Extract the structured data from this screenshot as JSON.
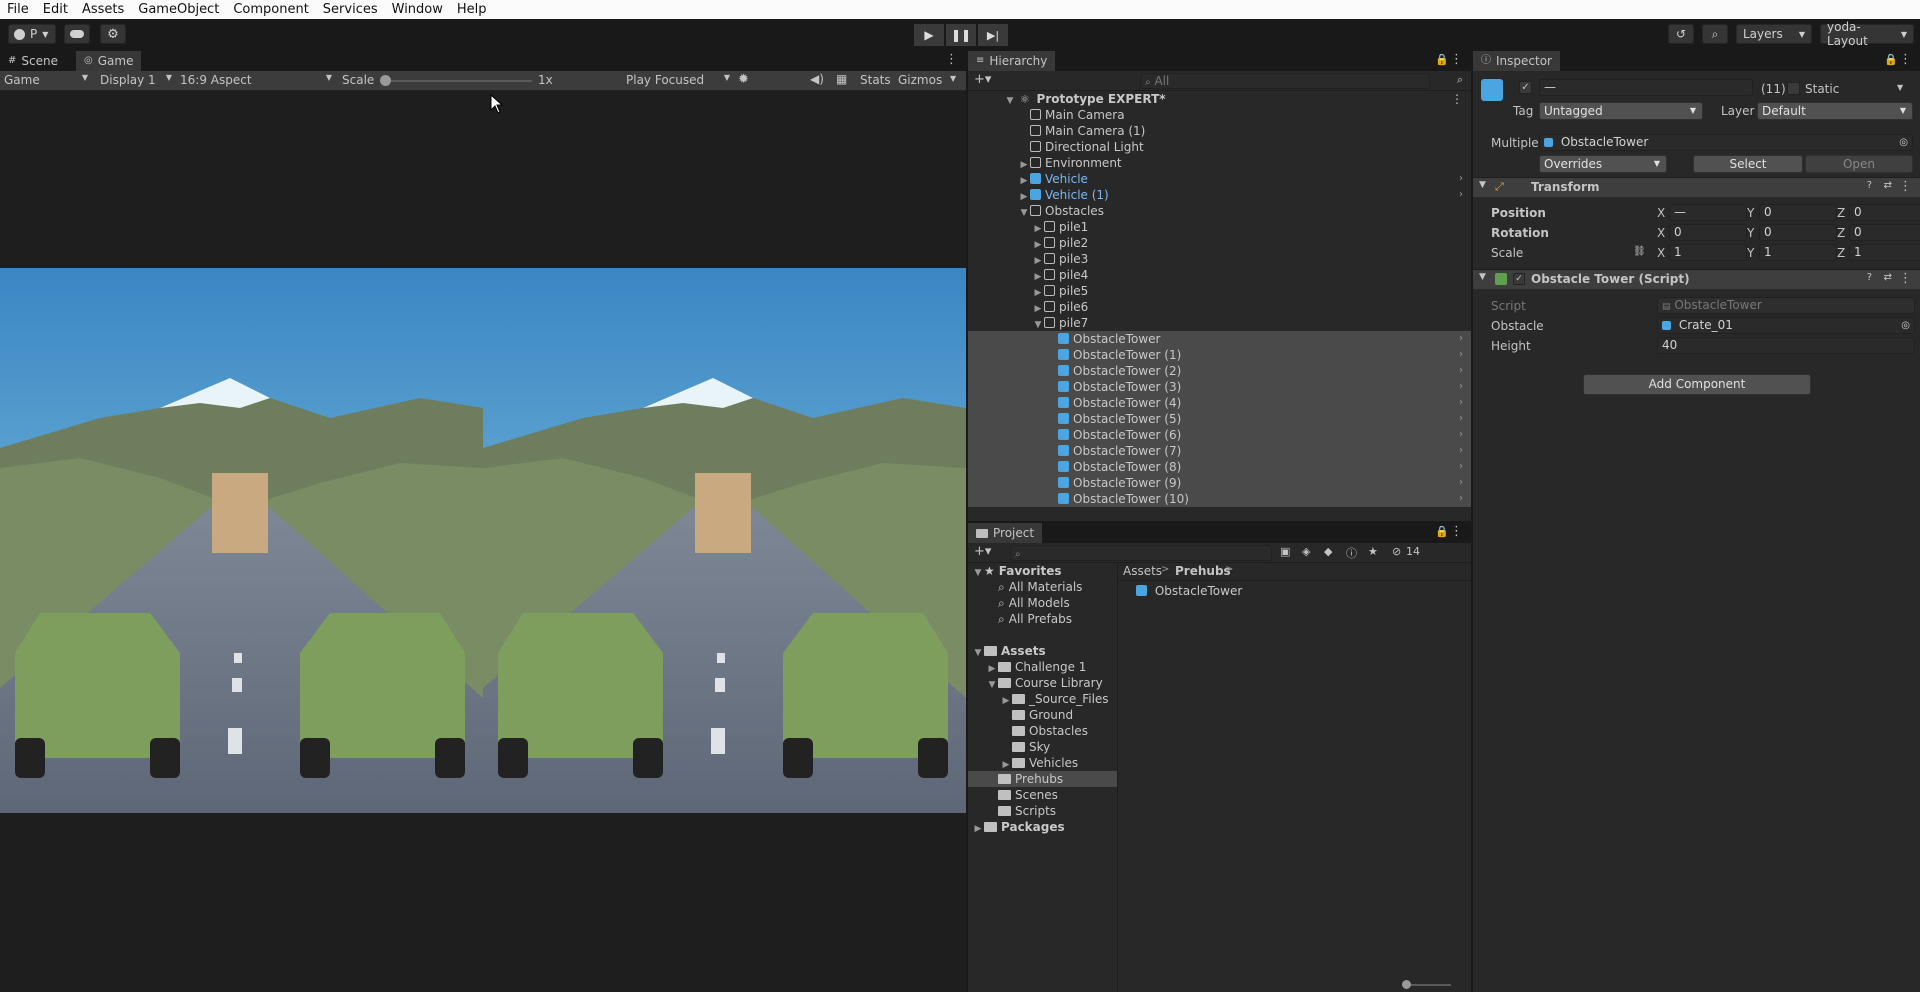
{
  "menu": [
    "File",
    "Edit",
    "Assets",
    "GameObject",
    "Component",
    "Services",
    "Window",
    "Help"
  ],
  "toolbar": {
    "account": "P",
    "layers": "Layers",
    "layout": "yoda-Layout"
  },
  "game_view": {
    "tabs": [
      "Scene",
      "Game"
    ],
    "display_mode": "Game",
    "display": "Display 1",
    "aspect": "16:9 Aspect",
    "scale_label": "Scale",
    "scale_value": "1x",
    "play_mode": "Play Focused",
    "stats": "Stats",
    "gizmos": "Gizmos"
  },
  "hierarchy": {
    "title": "Hierarchy",
    "search_placeholder": "All",
    "scene": "Prototype EXPERT*",
    "rows": [
      {
        "label": "Main Camera",
        "indent": 1,
        "icon": "cube",
        "arrow": ""
      },
      {
        "label": "Main Camera (1)",
        "indent": 1,
        "icon": "cube",
        "arrow": ""
      },
      {
        "label": "Directional Light",
        "indent": 1,
        "icon": "cube",
        "arrow": ""
      },
      {
        "label": "Environment",
        "indent": 1,
        "icon": "cube",
        "arrow": "▶"
      },
      {
        "label": "Vehicle",
        "indent": 1,
        "icon": "blue",
        "arrow": "▶",
        "blue": true
      },
      {
        "label": "Vehicle (1)",
        "indent": 1,
        "icon": "blue",
        "arrow": "▶",
        "blue": true
      },
      {
        "label": "Obstacles",
        "indent": 1,
        "icon": "cube",
        "arrow": "▼"
      },
      {
        "label": "pile1",
        "indent": 2,
        "icon": "cube",
        "arrow": "▶"
      },
      {
        "label": "pile2",
        "indent": 2,
        "icon": "cube",
        "arrow": "▶"
      },
      {
        "label": "pile3",
        "indent": 2,
        "icon": "cube",
        "arrow": "▶"
      },
      {
        "label": "pile4",
        "indent": 2,
        "icon": "cube",
        "arrow": "▶"
      },
      {
        "label": "pile5",
        "indent": 2,
        "icon": "cube",
        "arrow": "▶"
      },
      {
        "label": "pile6",
        "indent": 2,
        "icon": "cube",
        "arrow": "▶"
      },
      {
        "label": "pile7",
        "indent": 2,
        "icon": "cube",
        "arrow": "▼"
      },
      {
        "label": "ObstacleTower",
        "indent": 3,
        "icon": "blue",
        "arrow": "",
        "sel": true
      },
      {
        "label": "ObstacleTower (1)",
        "indent": 3,
        "icon": "blue",
        "arrow": "",
        "sel": true
      },
      {
        "label": "ObstacleTower (2)",
        "indent": 3,
        "icon": "blue",
        "arrow": "",
        "sel": true
      },
      {
        "label": "ObstacleTower (3)",
        "indent": 3,
        "icon": "blue",
        "arrow": "",
        "sel": true
      },
      {
        "label": "ObstacleTower (4)",
        "indent": 3,
        "icon": "blue",
        "arrow": "",
        "sel": true
      },
      {
        "label": "ObstacleTower (5)",
        "indent": 3,
        "icon": "blue",
        "arrow": "",
        "sel": true
      },
      {
        "label": "ObstacleTower (6)",
        "indent": 3,
        "icon": "blue",
        "arrow": "",
        "sel": true
      },
      {
        "label": "ObstacleTower (7)",
        "indent": 3,
        "icon": "blue",
        "arrow": "",
        "sel": true
      },
      {
        "label": "ObstacleTower (8)",
        "indent": 3,
        "icon": "blue",
        "arrow": "",
        "sel": true
      },
      {
        "label": "ObstacleTower (9)",
        "indent": 3,
        "icon": "blue",
        "arrow": "",
        "sel": true
      },
      {
        "label": "ObstacleTower (10)",
        "indent": 3,
        "icon": "blue",
        "arrow": "",
        "sel": true
      }
    ]
  },
  "project": {
    "title": "Project",
    "hidden_count": "14",
    "breadcrumb": [
      "Assets",
      "Prehubs"
    ],
    "asset": "ObstacleTower",
    "tree": [
      {
        "label": "Favorites",
        "indent": 0,
        "arrow": "▼",
        "bold": true,
        "icon": "star"
      },
      {
        "label": "All Materials",
        "indent": 1,
        "arrow": "",
        "icon": "search"
      },
      {
        "label": "All Models",
        "indent": 1,
        "arrow": "",
        "icon": "search"
      },
      {
        "label": "All Prefabs",
        "indent": 1,
        "arrow": "",
        "icon": "search"
      },
      {
        "label": "",
        "indent": 0,
        "arrow": "",
        "icon": "none"
      },
      {
        "label": "Assets",
        "indent": 0,
        "arrow": "▼",
        "bold": true,
        "icon": "folder"
      },
      {
        "label": "Challenge 1",
        "indent": 1,
        "arrow": "▶",
        "icon": "folder"
      },
      {
        "label": "Course Library",
        "indent": 1,
        "arrow": "▼",
        "icon": "folder"
      },
      {
        "label": "_Source_Files",
        "indent": 2,
        "arrow": "▶",
        "icon": "folder"
      },
      {
        "label": "Ground",
        "indent": 2,
        "arrow": "",
        "icon": "folder"
      },
      {
        "label": "Obstacles",
        "indent": 2,
        "arrow": "",
        "icon": "folder"
      },
      {
        "label": "Sky",
        "indent": 2,
        "arrow": "",
        "icon": "folder"
      },
      {
        "label": "Vehicles",
        "indent": 2,
        "arrow": "▶",
        "icon": "folder"
      },
      {
        "label": "Prehubs",
        "indent": 1,
        "arrow": "",
        "icon": "folder",
        "sel": true
      },
      {
        "label": "Scenes",
        "indent": 1,
        "arrow": "",
        "icon": "folder"
      },
      {
        "label": "Scripts",
        "indent": 1,
        "arrow": "",
        "icon": "folder"
      },
      {
        "label": "Packages",
        "indent": 0,
        "arrow": "▶",
        "bold": true,
        "icon": "folder"
      }
    ]
  },
  "inspector": {
    "title": "Inspector",
    "name_value": "—",
    "count": "(11)",
    "static_label": "Static",
    "tag_label": "Tag",
    "tag_value": "Untagged",
    "layer_label": "Layer",
    "layer_value": "Default",
    "multiple_label": "Multiple",
    "prefab": "ObstacleTower",
    "overrides": "Overrides",
    "select": "Select",
    "open": "Open",
    "transform": {
      "title": "Transform",
      "position_label": "Position",
      "rotation_label": "Rotation",
      "scale_label": "Scale",
      "position": [
        "—",
        "0",
        "0"
      ],
      "rotation": [
        "0",
        "0",
        "0"
      ],
      "scale": [
        "1",
        "1",
        "1"
      ],
      "axes": [
        "X",
        "Y",
        "Z"
      ]
    },
    "script": {
      "title": "Obstacle Tower (Script)",
      "script_label": "Script",
      "script_value": "ObstacleTower",
      "obstacle_label": "Obstacle",
      "obstacle_value": "Crate_01",
      "height_label": "Height",
      "height_value": "40"
    },
    "add_component": "Add Component"
  }
}
